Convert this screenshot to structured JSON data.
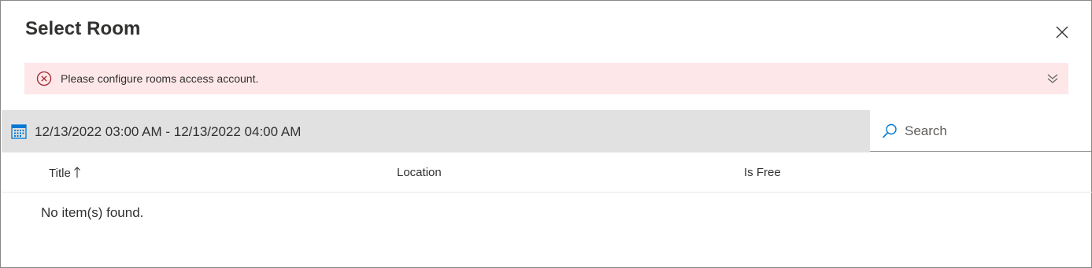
{
  "dialog": {
    "title": "Select Room",
    "close_icon": "close-icon"
  },
  "message_bar": {
    "text": "Please configure rooms access account.",
    "icon": "error-circle-icon",
    "expand_icon": "double-chevron-down-icon",
    "background": "#fde7e9",
    "icon_color": "#a4262c"
  },
  "toolbar": {
    "date_range": "12/13/2022 03:00 AM - 12/13/2022 04:00 AM",
    "calendar_icon": "calendar-icon",
    "calendar_icon_color": "#0078d4"
  },
  "search": {
    "placeholder": "Search",
    "icon": "search-icon"
  },
  "table": {
    "columns": [
      {
        "label": "Title",
        "sorted": "ascending"
      },
      {
        "label": "Location"
      },
      {
        "label": "Is Free"
      }
    ],
    "empty_message": "No item(s) found."
  }
}
